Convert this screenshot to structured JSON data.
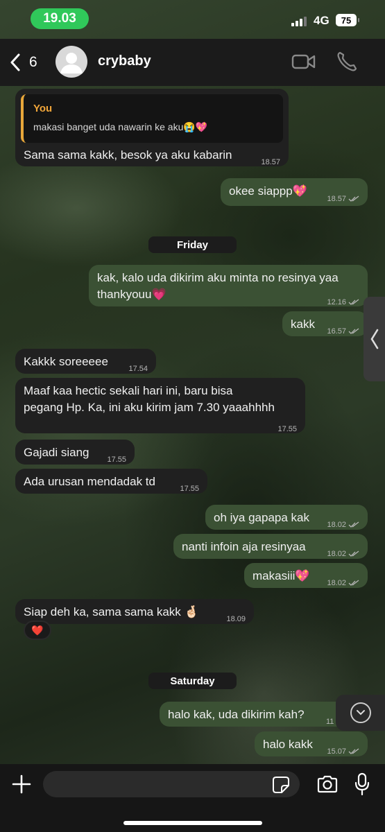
{
  "status_bar": {
    "time": "19.03",
    "network": "4G",
    "battery": "75"
  },
  "header": {
    "back_count": "6",
    "contact_name": "crybaby"
  },
  "reply": {
    "quote_author": "You",
    "quote_text": "makasi banget uda nawarin ke aku😭💖",
    "text": "Sama sama kakk, besok ya aku kabarin",
    "time": "18.57"
  },
  "messages": [
    {
      "text": "okee siappp💖",
      "time": "18.57"
    },
    {
      "text": "Friday"
    },
    {
      "text": "kak, kalo uda dikirim aku minta no resinya yaa",
      "text2": "thankyouu💗",
      "time": "12.16"
    },
    {
      "text": "kakk",
      "time": "16.57"
    },
    {
      "text": "Kakkk soreeeee",
      "time": "17.54"
    },
    {
      "text": "Maaf kaa hectic sekali hari ini, baru bisa",
      "text2": "pegang Hp. Ka, ini aku kirim jam 7.30 yaaahhhh",
      "time": "17.55"
    },
    {
      "text": "Gajadi siang",
      "time": "17.55"
    },
    {
      "text": "Ada urusan mendadak td",
      "time": "17.55"
    },
    {
      "text": "oh iya gapapa kak",
      "time": "18.02"
    },
    {
      "text": "nanti infoin aja resinyaa",
      "time": "18.02"
    },
    {
      "text": "makasiii💖",
      "time": "18.02"
    },
    {
      "text": "Siap deh ka, sama sama kakk 🤞🏻",
      "time": "18.09",
      "reaction": "❤️"
    },
    {
      "text": "Saturday"
    },
    {
      "text": "halo kak, uda dikirim kah?",
      "time": "11"
    },
    {
      "text": "halo kakk",
      "time": "15.07"
    }
  ],
  "input": {
    "placeholder": ""
  },
  "icons": {
    "back": "chevron-left-icon",
    "video": "video-camera-icon",
    "call": "phone-icon",
    "plus": "plus-icon",
    "sticker": "sticker-icon",
    "camera": "camera-icon",
    "mic": "microphone-icon",
    "scroll_down": "chevron-down-icon"
  },
  "colors": {
    "time_pill": "#30c85a",
    "outgoing": "#3b5134",
    "incoming": "#202020",
    "quote_accent": "#e8a73a"
  }
}
